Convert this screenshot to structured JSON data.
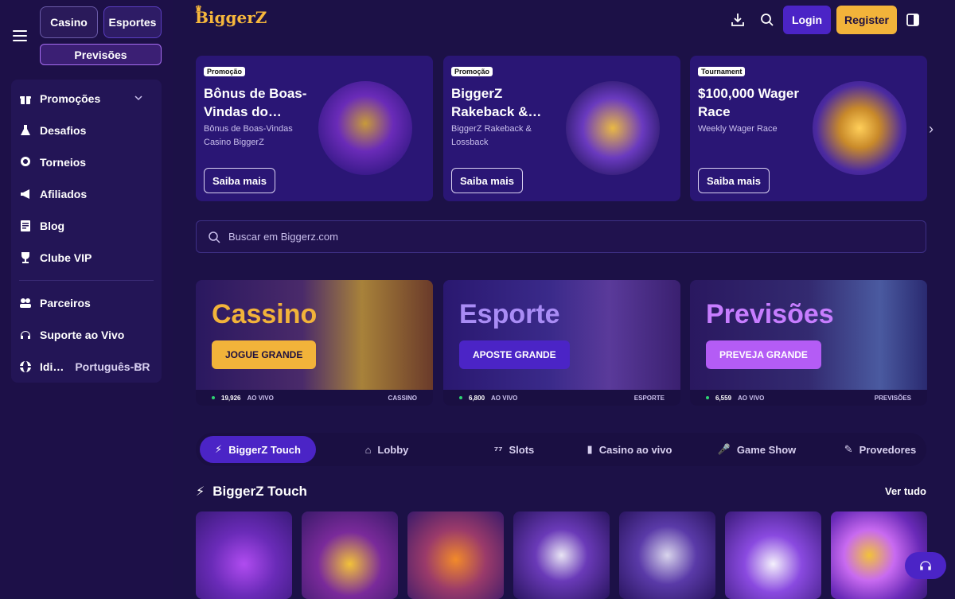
{
  "sidebar": {
    "tabs": {
      "casino": "Casino",
      "esportes": "Esportes",
      "previsoes": "Previsões"
    },
    "items": [
      {
        "label": "Promoções",
        "icon": "gift-icon"
      },
      {
        "label": "Desafios",
        "icon": "flask-icon"
      },
      {
        "label": "Torneios",
        "icon": "trophy-icon"
      },
      {
        "label": "Afiliados",
        "icon": "megaphone-icon"
      },
      {
        "label": "Blog",
        "icon": "blog-icon"
      },
      {
        "label": "Clube VIP",
        "icon": "trophy-cup-icon"
      }
    ],
    "items2": [
      {
        "label": "Parceiros",
        "icon": "partners-icon"
      },
      {
        "label": "Suporte ao Vivo",
        "icon": "headset-icon"
      }
    ],
    "language": {
      "label": "Idi…",
      "value": "Português-BR"
    }
  },
  "header": {
    "logo": "BiggerZ",
    "login": "Login",
    "register": "Register"
  },
  "promos": [
    {
      "badge": "Promoção",
      "title": "Bônus de Boas-Vindas do…",
      "subtitle": "Bônus de Boas-Vindas Casino BiggerZ",
      "button": "Saiba mais"
    },
    {
      "badge": "Promoção",
      "title": "BiggerZ Rakeback &…",
      "subtitle": "BiggerZ Rakeback & Lossback",
      "button": "Saiba mais"
    },
    {
      "badge": "Tournament",
      "title": "$100,000 Wager Race",
      "subtitle": "Weekly Wager Race",
      "button": "Saiba mais"
    }
  ],
  "search": {
    "placeholder": "Buscar em Biggerz.com"
  },
  "categories": [
    {
      "title": "Cassino",
      "button": "JOGUE GRANDE",
      "count": "19,926",
      "live": "AO VIVO",
      "name": "CASSINO"
    },
    {
      "title": "Esporte",
      "button": "APOSTE GRANDE",
      "count": "6,800",
      "live": "AO VIVO",
      "name": "ESPORTE"
    },
    {
      "title": "Previsões",
      "button": "PREVEJA GRANDE",
      "count": "6,559",
      "live": "AO VIVO",
      "name": "PREVISÕES"
    }
  ],
  "game_tabs": [
    {
      "label": "BiggerZ Touch",
      "icon": "lightning-icon"
    },
    {
      "label": "Lobby",
      "icon": "home-icon"
    },
    {
      "label": "Slots",
      "icon": "slots-icon"
    },
    {
      "label": "Casino ao vivo",
      "icon": "cards-icon"
    },
    {
      "label": "Game Show",
      "icon": "microphone-icon"
    },
    {
      "label": "Provedores",
      "icon": "providers-icon"
    }
  ],
  "section": {
    "title": "BiggerZ Touch",
    "see_all": "Ver tudo"
  },
  "colors": {
    "bg": "#1c1147",
    "accent": "#4b24c6",
    "gold": "#f2b33a",
    "pink": "#a855f7"
  }
}
